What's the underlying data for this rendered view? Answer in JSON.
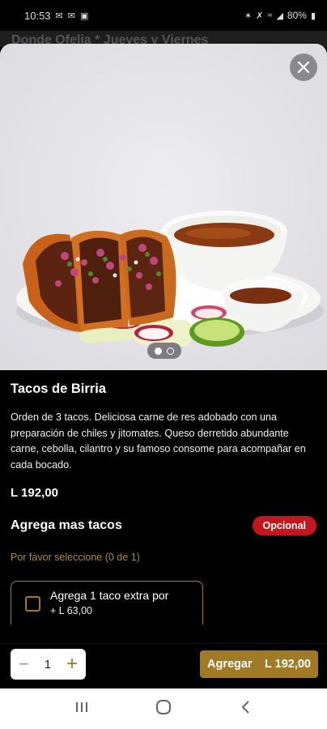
{
  "status_bar": {
    "time": "10:53",
    "battery": "80%",
    "left_icons": [
      "mail-icon",
      "mail-icon",
      "image-icon"
    ],
    "right_icons": [
      "bluetooth-icon",
      "mute-icon",
      "wifi-icon",
      "signal-icon",
      "battery-icon"
    ]
  },
  "background_header": {
    "text": "Donde Ofelia * Jueves y Viernes"
  },
  "product": {
    "title": "Tacos de Birria",
    "description": "Orden de 3 tacos. Deliciosa carne de res adobado con una preparación de chiles y jitomates. Queso derretido abundante carne, cebolla, cilantro y su famoso consome para acompañar en cada bocado.",
    "price": "L 192,00",
    "image_pager": {
      "count": 2,
      "active": 0
    }
  },
  "option_group": {
    "title": "Agrega mas tacos",
    "badge": "Opcional",
    "hint": "Por favor seleccione (0 de 1)",
    "options": [
      {
        "label": "Agrega 1 taco extra por",
        "price": "+ L 63,00",
        "checked": false
      }
    ]
  },
  "action_bar": {
    "quantity": "1",
    "minus_label": "−",
    "plus_label": "+",
    "add_label": "Agregar",
    "add_total": "L 192,00"
  },
  "colors": {
    "accent_gold": "#a17a26",
    "badge_red": "#c4161c",
    "background": "#000000"
  }
}
